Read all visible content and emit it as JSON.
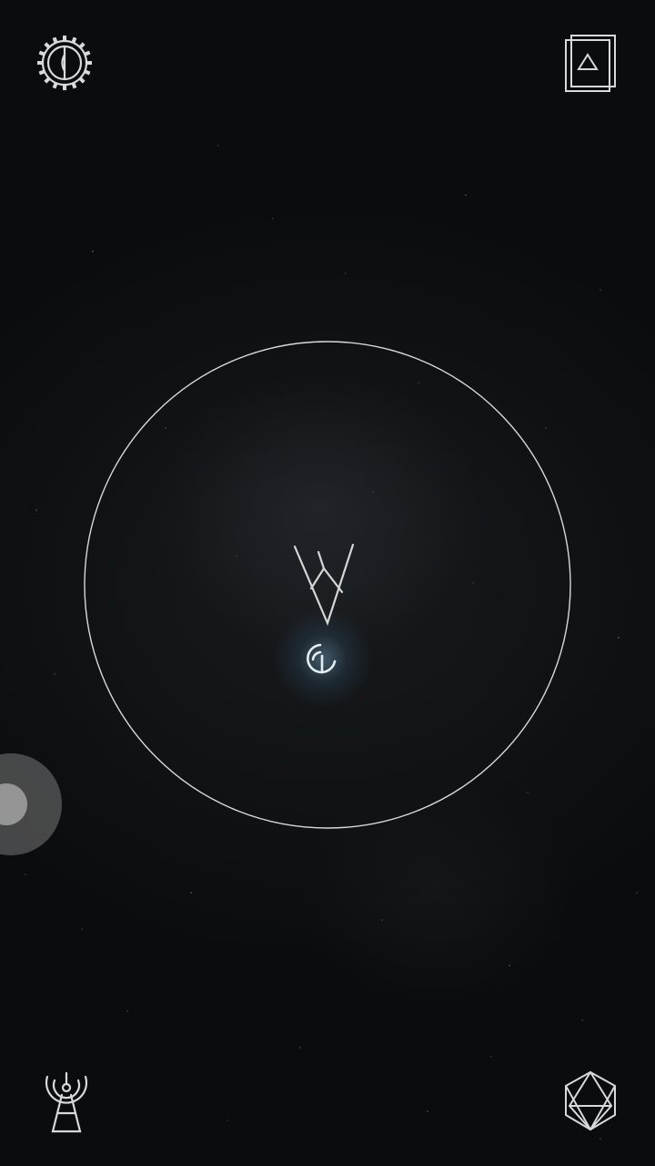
{
  "screen": {
    "title": ""
  },
  "colors": {
    "background": "#0d0f10",
    "line": "#d9d9d9",
    "glow": "#78aac8",
    "joystick": "#787878"
  },
  "icons": {
    "top_left": "settings-gear-icon",
    "top_right": "card-deck-triangle-icon",
    "bottom_left": "signal-tower-icon",
    "bottom_right": "polyhedron-icon",
    "player": "chevron-ship-icon",
    "target": "crescent-rune-icon"
  }
}
